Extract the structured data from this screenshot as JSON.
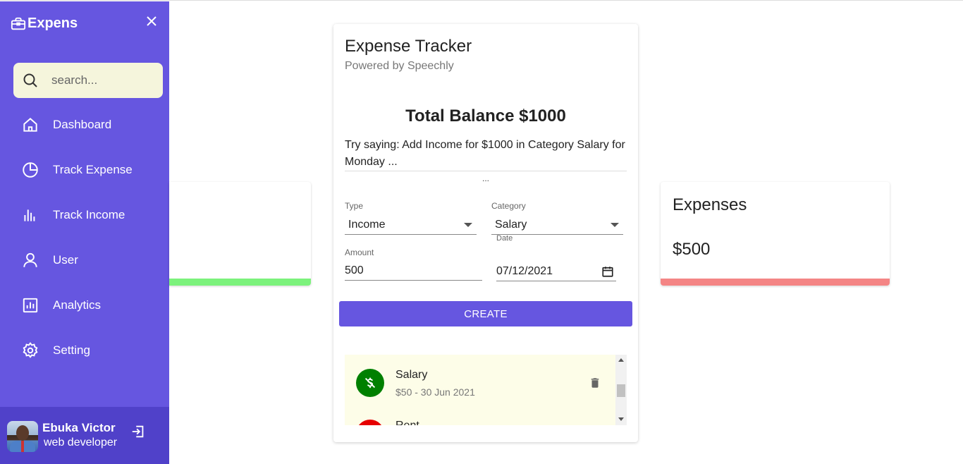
{
  "sidebar": {
    "brand": "Expens",
    "search_placeholder": "search...",
    "items": [
      {
        "label": "Dashboard",
        "icon": "home-icon"
      },
      {
        "label": "Track Expense",
        "icon": "pie-chart-icon"
      },
      {
        "label": "Track Income",
        "icon": "bar-chart-icon"
      },
      {
        "label": "User",
        "icon": "user-icon"
      },
      {
        "label": "Analytics",
        "icon": "analytics-icon"
      },
      {
        "label": "Setting",
        "icon": "gear-icon"
      }
    ],
    "profile": {
      "name": "Ebuka Victor",
      "role": "web developer"
    }
  },
  "tracker": {
    "title": "Expense Tracker",
    "subtitle": "Powered by Speechly",
    "balance": "Total Balance $1000",
    "hint": "Try saying: Add Income for $1000 in Category Salary for Monday ...",
    "dots": "...",
    "form": {
      "type_label": "Type",
      "type_value": "Income",
      "category_label": "Category",
      "category_value": "Salary",
      "amount_label": "Amount",
      "amount_value": "500",
      "date_label": "Date",
      "date_value": "07/12/2021",
      "create_label": "CREATE"
    },
    "transactions": [
      {
        "name": "Salary",
        "meta": "$50 - 30 Jun 2021",
        "color": "#008000"
      },
      {
        "name": "Rent",
        "meta": "",
        "color": "#e60000"
      }
    ]
  },
  "expenses_card": {
    "title": "Expenses",
    "amount": "$500"
  },
  "colors": {
    "sidebar": "#6656e0",
    "profile": "#5041c9",
    "income_bar": "#7cf27c",
    "expense_bar": "#f48585",
    "list_bg": "#fdfde8"
  }
}
